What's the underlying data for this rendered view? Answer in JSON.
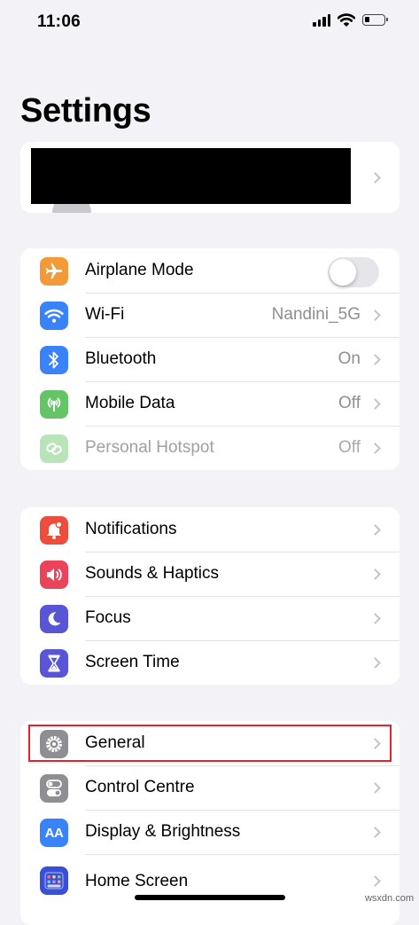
{
  "status_bar": {
    "time": "11:06"
  },
  "title": "Settings",
  "groups": [
    {
      "rows": [
        {
          "label": "Airplane Mode",
          "value": "",
          "icon": "airplane-icon",
          "color": "#f19a37",
          "toggle": false
        },
        {
          "label": "Wi-Fi",
          "value": "Nandini_5G",
          "icon": "wifi-icon",
          "color": "#3a82f7"
        },
        {
          "label": "Bluetooth",
          "value": "On",
          "icon": "bluetooth-icon",
          "color": "#3a82f7"
        },
        {
          "label": "Mobile Data",
          "value": "Off",
          "icon": "antenna-icon",
          "color": "#65c466"
        },
        {
          "label": "Personal Hotspot",
          "value": "Off",
          "icon": "hotspot-icon",
          "color": "#65c466"
        }
      ]
    },
    {
      "rows": [
        {
          "label": "Notifications",
          "icon": "bell-icon",
          "color": "#eb4e3d"
        },
        {
          "label": "Sounds & Haptics",
          "icon": "speaker-icon",
          "color": "#eb445a"
        },
        {
          "label": "Focus",
          "icon": "moon-icon",
          "color": "#5856d6"
        },
        {
          "label": "Screen Time",
          "icon": "hourglass-icon",
          "color": "#5856d6"
        }
      ]
    },
    {
      "rows": [
        {
          "label": "General",
          "icon": "gear-icon",
          "color": "#8e8e93"
        },
        {
          "label": "Control Centre",
          "icon": "toggles-icon",
          "color": "#8e8e93"
        },
        {
          "label": "Display & Brightness",
          "icon": "text-size-icon",
          "color": "#3a82f7",
          "icon_text": "AA"
        },
        {
          "label": "Home Screen",
          "icon": "app-grid-icon",
          "color": "#3a4fd8"
        }
      ]
    }
  ],
  "watermark": "wsxdn.com"
}
